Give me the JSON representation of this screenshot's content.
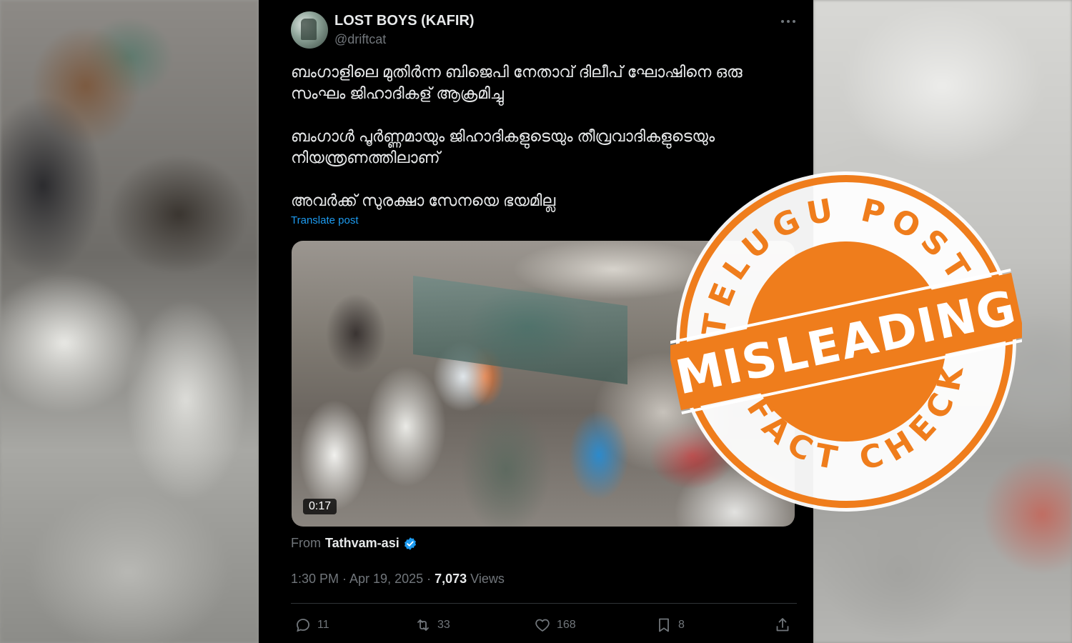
{
  "tweet": {
    "display_name": "LOST BOYS (KAFIR)",
    "handle": "@driftcat",
    "more_icon": "more-horizontal-icon",
    "text_paragraphs": [
      "ബംഗാളിലെ മുതിർന്ന ബിജെപി നേതാവ് ദിലീപ് ഘോഷിനെ ഒരു സംഘം ജിഹാദികള് ആക്രമിച്ചു",
      "ബംഗാൾ പൂർണ്ണമായും ജിഹാദികളുടെയും തീവ്രവാദികളുടെയും നിയന്ത്രണത്തിലാണ്",
      "അവർക്ക് സുരക്ഷാ സേനയെ ഭയമില്ല"
    ],
    "translate_label": "Translate post",
    "video_duration": "0:17",
    "from_label": "From",
    "from_user": "Tathvam-asi",
    "timestamp": "1:30 PM · Apr 19, 2025 · ",
    "views_count": "7,073",
    "views_label": " Views",
    "actions": {
      "replies": "11",
      "reposts": "33",
      "likes": "168",
      "bookmarks": "8"
    }
  },
  "stamp": {
    "top_text": "TELUGU POST",
    "center_text": "MISLEADING",
    "bottom_text": "FACT CHECK",
    "color": "#ef7d1c"
  },
  "colors": {
    "tweet_bg": "#000000",
    "text": "#e7e9ea",
    "muted": "#71767b",
    "link": "#1d9bf0",
    "stamp_orange": "#ef7d1c"
  }
}
